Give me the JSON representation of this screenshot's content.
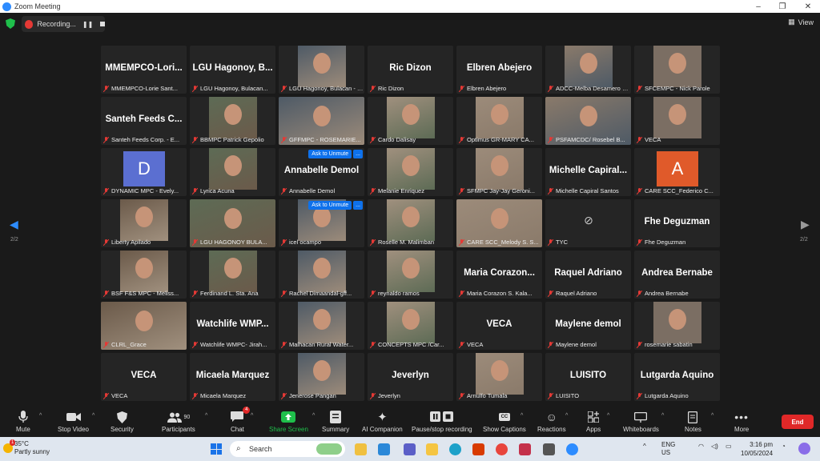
{
  "window": {
    "title": "Zoom Meeting"
  },
  "topbar": {
    "recording_label": "Recording...",
    "view_label": "View"
  },
  "nav": {
    "page_left": "2/2",
    "page_right": "2/2"
  },
  "tiles": [
    {
      "big": "MMEMPCO-Lori...",
      "name": "MMEMPCO-Lorie Sant..."
    },
    {
      "big": "LGU Hagonoy, B...",
      "name": "LGU Hagonoy, Bulacan..."
    },
    {
      "name": "LGU Hagonoy, Bulacan - F..."
    },
    {
      "big": "Ric Dizon",
      "name": "Ric Dizon"
    },
    {
      "big": "Elbren Abejero",
      "name": "Elbren Abejero"
    },
    {
      "name": "ADCC-Melba Desamero &..."
    },
    {
      "name": "SFCEMPC - Nick Parole"
    },
    {
      "big": "Santeh Feeds C...",
      "name": "Santeh Feeds Corp. - E..."
    },
    {
      "name": "BBMPC Patrick Gepolio"
    },
    {
      "name": "GFFMPC - ROSEMARIE..."
    },
    {
      "name": "Cardo Dalisay"
    },
    {
      "name": "Optimus GR-MARY CA..."
    },
    {
      "name": "PSFAMCDC/ Rosebel B..."
    },
    {
      "name": "VECA"
    },
    {
      "letter": "D",
      "name": "DYNAMIC MPC - Evely..."
    },
    {
      "name": "Lyrica Acuna"
    },
    {
      "big": "Annabelle Demol",
      "name": "Annabelle Demol"
    },
    {
      "name": "Melanie Enriquez"
    },
    {
      "name": "SFMPC Jay-Jay Geroni..."
    },
    {
      "big": "Michelle Capiral...",
      "name": "Michelle Capiral Santos"
    },
    {
      "letter": "A",
      "name": "CARE SCC_Federico C..."
    },
    {
      "name": "Liberty Apilado"
    },
    {
      "name": "LGU HAGONOY BULA..."
    },
    {
      "name": "icel ocampo"
    },
    {
      "name": "Roselle M. Malimban"
    },
    {
      "name": "CARE SCC_Melody S. S..."
    },
    {
      "name": "TYC"
    },
    {
      "big": "Fhe Deguzman",
      "name": "Fhe Deguzman"
    },
    {
      "name": "BSF F&S MPC - Meliss..."
    },
    {
      "name": "Ferdinand L. Sta. Ana"
    },
    {
      "name": "Rachel Dimaandal-gff..."
    },
    {
      "name": "reynaldo ramos"
    },
    {
      "big": "Maria Corazon...",
      "name": "Maria Corazon S. Kala..."
    },
    {
      "big": "Raquel Adriano",
      "name": "Raquel Adriano"
    },
    {
      "big": "Andrea Bernabe",
      "name": "Andrea Bernabe"
    },
    {
      "name": "CLRL_Grace"
    },
    {
      "big": "Watchlife WMP...",
      "name": "Watchlife WMPC- Jirah..."
    },
    {
      "name": "Malhacan Rural Water..."
    },
    {
      "name": "CONCEPTS MPC /Car..."
    },
    {
      "big": "VECA",
      "name": "VECA"
    },
    {
      "big": "Maylene demol",
      "name": "Maylene demol"
    },
    {
      "name": "rosemarie sabatin"
    },
    {
      "big": "VECA",
      "name": "VECA"
    },
    {
      "big": "Micaela Marquez",
      "name": "Micaela Marquez"
    },
    {
      "name": "Jenerose Pangan"
    },
    {
      "big": "Jeverlyn",
      "name": "Jeverlyn"
    },
    {
      "name": "Arnulfo Tumala"
    },
    {
      "big": "LUISITO",
      "name": "LUISITO"
    },
    {
      "big": "Lutgarda Aquino",
      "name": "Lutgarda Aquino"
    }
  ],
  "unmute": {
    "label": "Ask to Unmute",
    "more": "..."
  },
  "toolbar": {
    "mute": "Mute",
    "stop_video": "Stop Video",
    "security": "Security",
    "participants": "Participants",
    "participants_count": "90",
    "chat": "Chat",
    "chat_badge": "4",
    "share_screen": "Share Screen",
    "summary": "Summary",
    "ai_companion": "AI Companion",
    "pause_recording": "Pause/stop recording",
    "show_captions": "Show Captions",
    "reactions": "Reactions",
    "apps": "Apps",
    "whiteboards": "Whiteboards",
    "notes": "Notes",
    "more": "More",
    "end": "End",
    "captions_icon_text": "CC"
  },
  "taskbar": {
    "temp": "35°C",
    "weather": "Partly sunny",
    "search": "Search",
    "lang1": "ENG",
    "lang2": "US",
    "time": "3:16 pm",
    "date": "10/05/2024",
    "weather_badge": "1"
  },
  "colors": {
    "accent": "#2d8cff",
    "end": "#e02828",
    "share": "#1fbf4b",
    "unmute": "#0e71eb"
  }
}
